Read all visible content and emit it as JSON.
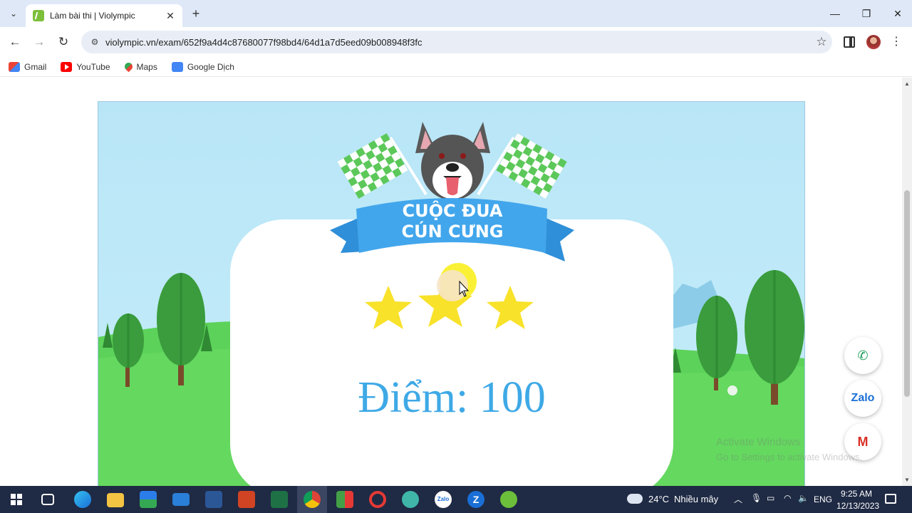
{
  "browser": {
    "tab_title": "Làm bài thi | Violympic",
    "url": "violympic.vn/exam/652f9a4d4c87680077f98bd4/64d1a7d5eed09b008948f3fc",
    "bookmarks": [
      "Gmail",
      "YouTube",
      "Maps",
      "Google Dịch"
    ]
  },
  "game": {
    "banner_line1": "CUỘC ĐUA",
    "banner_line2": "CÚN CƯNG",
    "score_text": "Điểm:  100",
    "stars": 3
  },
  "contact": {
    "zalo_label": "Zalo"
  },
  "watermark": {
    "line1": "Activate Windows",
    "line2": "Go to Settings to activate Windows."
  },
  "taskbar": {
    "weather": "24°C",
    "weather_desc": "Nhiều mây",
    "lang": "ENG",
    "time": "9:25 AM",
    "date": "12/13/2023"
  }
}
